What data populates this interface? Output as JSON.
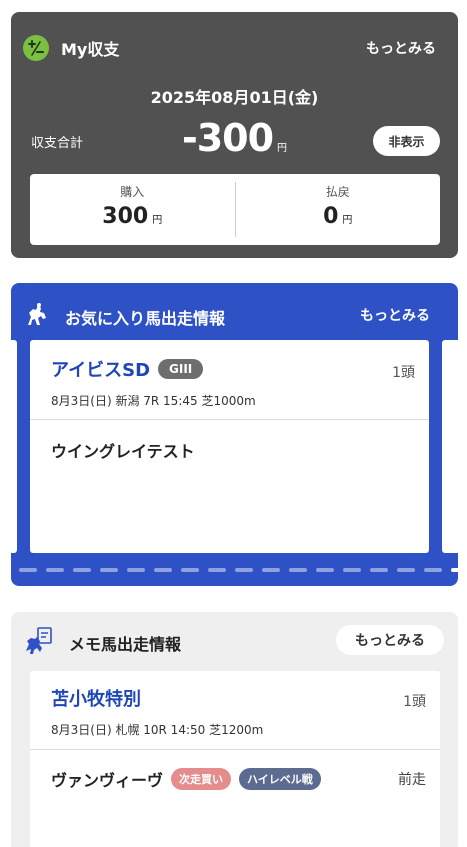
{
  "balance": {
    "title": "My収支",
    "more": "もっとみる",
    "date": "2025年08月01日(金)",
    "total_label": "収支合計",
    "total_value": "-300",
    "unit": "円",
    "hide_button": "非表示",
    "buy_label": "購入",
    "buy_value": "300",
    "payout_label": "払戻",
    "payout_value": "0",
    "icon": "plus-minus-icon",
    "accent": "#7bc043"
  },
  "favorites": {
    "title": "お気に入り馬出走情報",
    "more": "もっとみる",
    "icon": "horse-rider-icon",
    "accent": "#2e52c6",
    "race": {
      "name": "アイビスSD",
      "grade": "GIII",
      "count": "1頭",
      "info": "8月3日(日) 新潟 7R 15:45 芝1000m"
    },
    "horses": [
      "ウイングレイテスト"
    ],
    "pager": {
      "pages": 17,
      "active": 16
    }
  },
  "memo": {
    "title": "メモ馬出走情報",
    "more": "もっとみる",
    "icon": "memo-horse-icon",
    "race": {
      "name": "苫小牧特別",
      "count": "1頭",
      "info": "8月3日(日) 札幌 10R 14:50 芝1200m"
    },
    "horse": {
      "name": "ヴァンヴィーヴ",
      "tags": [
        "次走買い",
        "ハイレベル戦"
      ],
      "note": "前走"
    }
  }
}
